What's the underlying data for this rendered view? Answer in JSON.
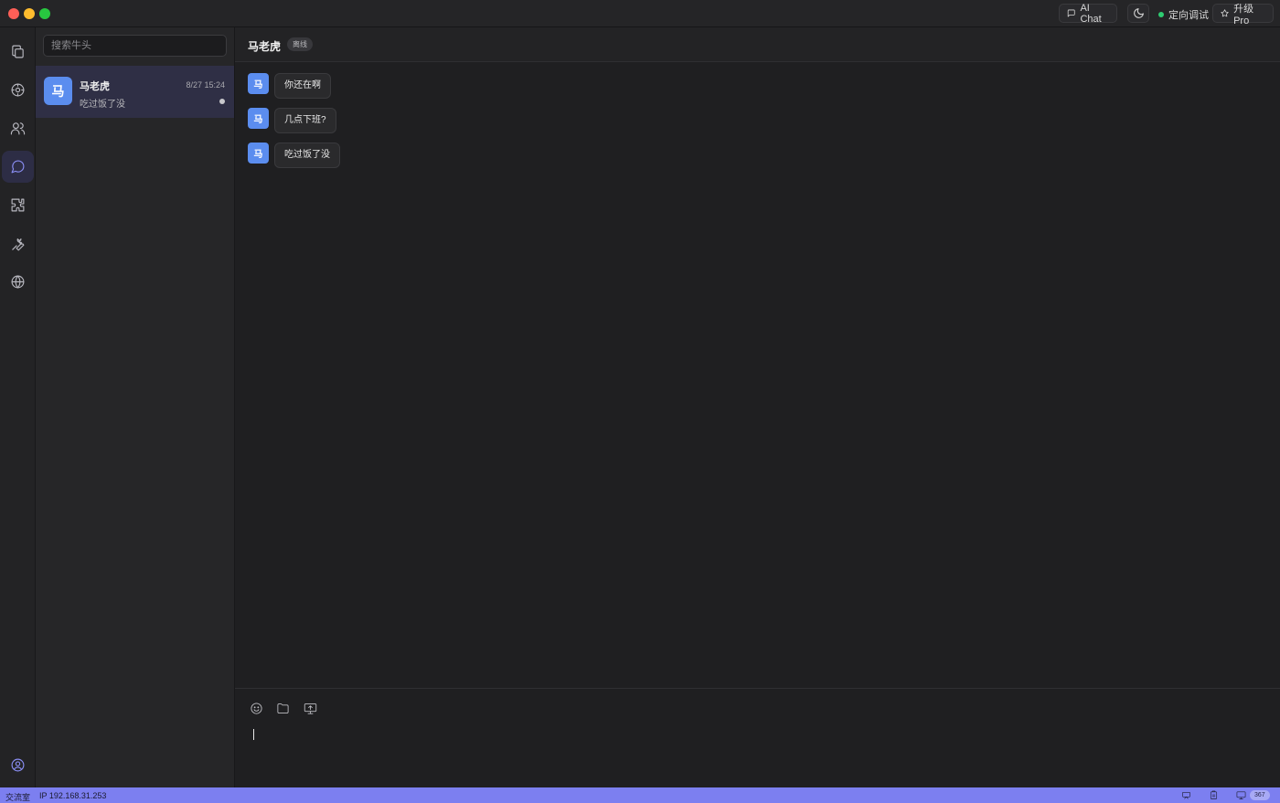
{
  "titlebar": {
    "ai_chat_label": "AI Chat",
    "status_label": "定向调试",
    "upgrade_label": "升级 Pro"
  },
  "sidebar": {
    "items": [
      {
        "name": "copy",
        "icon": "copy-icon",
        "active": false
      },
      {
        "name": "discover",
        "icon": "compass-icon",
        "active": false
      },
      {
        "name": "contacts",
        "icon": "users-icon",
        "active": false
      },
      {
        "name": "chat",
        "icon": "chat-bubble-icon",
        "active": true
      },
      {
        "name": "plugins",
        "icon": "puzzle-icon",
        "active": false
      },
      {
        "name": "tools",
        "icon": "wrench-icon",
        "active": false
      },
      {
        "name": "network",
        "icon": "globe-icon",
        "active": false
      }
    ],
    "profile_icon": "user-circle-icon"
  },
  "search": {
    "placeholder": "搜索牛头"
  },
  "conversations": [
    {
      "avatar": "马",
      "name": "马老虎",
      "time": "8/27 15:24",
      "last_message": "吃过饭了没",
      "unread_dot": true
    }
  ],
  "chat": {
    "title": "马老虎",
    "status_badge": "离线",
    "messages": [
      {
        "avatar": "马",
        "text": "你还在啊"
      },
      {
        "avatar": "马",
        "text": "几点下班?"
      },
      {
        "avatar": "马",
        "text": "吃过饭了没"
      }
    ],
    "tools": [
      "emoji-icon",
      "folder-icon",
      "screen-share-icon"
    ]
  },
  "statusbar": {
    "room": "交流室",
    "ip": "IP 192.168.31.253",
    "online_count": "367"
  },
  "colors": {
    "accent": "#7c7ff0",
    "avatar": "#5b8def",
    "online": "#2ecc71"
  }
}
